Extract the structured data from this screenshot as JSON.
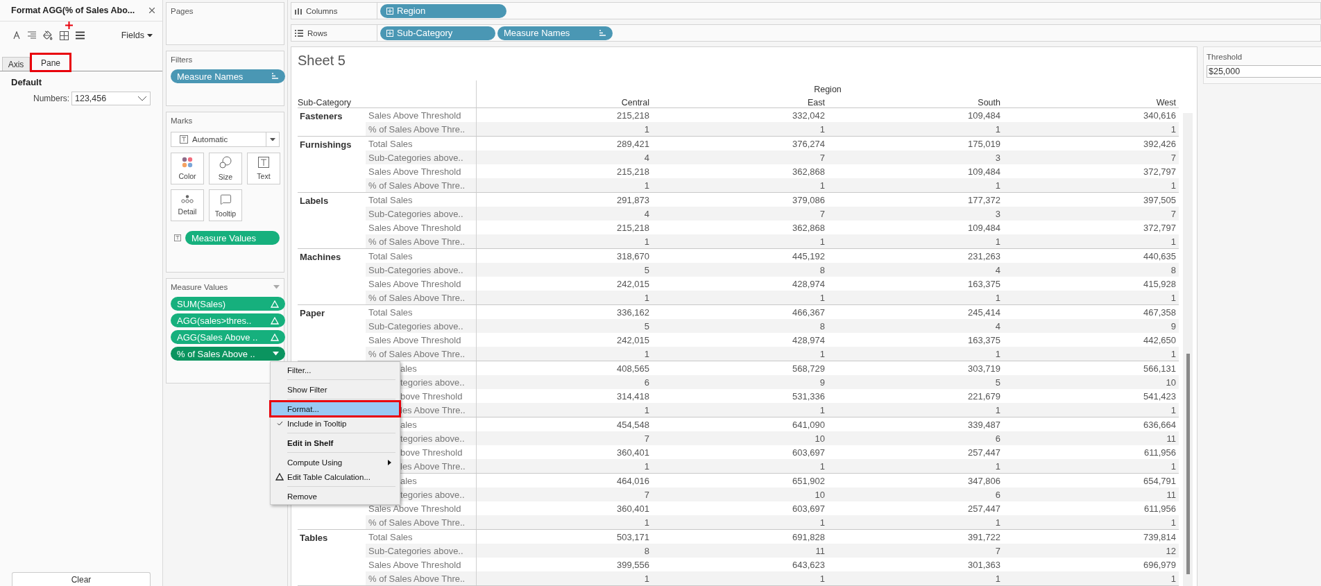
{
  "format_pane": {
    "title": "Format AGG(% of Sales Abo...",
    "fields_button": "Fields",
    "tabs": [
      {
        "label": "Axis",
        "selected": false,
        "annotated": false
      },
      {
        "label": "Pane",
        "selected": true,
        "annotated": true
      }
    ],
    "section": "Default",
    "numbers_label": "Numbers:",
    "numbers_value": "123,456",
    "clear_button": "Clear"
  },
  "cards": {
    "pages": {
      "title": "Pages"
    },
    "filters": {
      "title": "Filters",
      "pills": [
        {
          "label": "Measure Names",
          "kind": "sorted"
        }
      ]
    },
    "marks": {
      "title": "Marks",
      "mark_type": "Automatic",
      "buttons": [
        {
          "label": "Color",
          "kind": "color"
        },
        {
          "label": "Size",
          "kind": "size"
        },
        {
          "label": "Text",
          "kind": "text"
        },
        {
          "label": "Detail",
          "kind": "detail"
        },
        {
          "label": "Tooltip",
          "kind": "tooltip"
        }
      ],
      "text_pill": "Measure Values"
    },
    "measure_values": {
      "title": "Measure Values",
      "pills": [
        {
          "label": "SUM(Sales)",
          "selected": false
        },
        {
          "label": "AGG(sales>thres..",
          "selected": false
        },
        {
          "label": "AGG(Sales Above ..",
          "selected": false
        },
        {
          "label": "% of Sales Above ..",
          "selected": true
        }
      ]
    }
  },
  "shelves": [
    {
      "kind": "columns",
      "label": "Columns",
      "pills": [
        {
          "label": "Region",
          "kind": "hierarchy"
        }
      ]
    },
    {
      "kind": "rows",
      "label": "Rows",
      "pills": [
        {
          "label": "Sub-Category",
          "kind": "hierarchy"
        },
        {
          "label": "Measure Names",
          "kind": "sorted"
        }
      ]
    }
  ],
  "sheet": {
    "title": "Sheet 5",
    "column_header": "Region",
    "row_header": "Sub-Category",
    "columns": [
      "Central",
      "East",
      "South",
      "West"
    ],
    "groups": [
      {
        "name": "Fasteners",
        "rows": [
          {
            "label": "Sales Above Threshold",
            "covered": false,
            "values": [
              "215,218",
              "332,042",
              "109,484",
              "340,616"
            ]
          },
          {
            "label": "% of Sales Above Thre..",
            "covered": false,
            "values": [
              "1",
              "1",
              "1",
              "1"
            ]
          }
        ]
      },
      {
        "name": "Furnishings",
        "rows": [
          {
            "label": "Total Sales",
            "covered": false,
            "values": [
              "289,421",
              "376,274",
              "175,019",
              "392,426"
            ]
          },
          {
            "label": "Sub-Categories above..",
            "covered": false,
            "values": [
              "4",
              "7",
              "3",
              "7"
            ]
          },
          {
            "label": "Sales Above Threshold",
            "covered": false,
            "values": [
              "215,218",
              "362,868",
              "109,484",
              "372,797"
            ]
          },
          {
            "label": "% of Sales Above Thre..",
            "covered": false,
            "values": [
              "1",
              "1",
              "1",
              "1"
            ]
          }
        ]
      },
      {
        "name": "Labels",
        "rows": [
          {
            "label": "Total Sales",
            "covered": false,
            "values": [
              "291,873",
              "379,086",
              "177,372",
              "397,505"
            ]
          },
          {
            "label": "Sub-Categories above..",
            "covered": false,
            "values": [
              "4",
              "7",
              "3",
              "7"
            ]
          },
          {
            "label": "Sales Above Threshold",
            "covered": false,
            "values": [
              "215,218",
              "362,868",
              "109,484",
              "372,797"
            ]
          },
          {
            "label": "% of Sales Above Thre..",
            "covered": false,
            "values": [
              "1",
              "1",
              "1",
              "1"
            ]
          }
        ]
      },
      {
        "name": "Machines",
        "rows": [
          {
            "label": "Total Sales",
            "covered": false,
            "values": [
              "318,670",
              "445,192",
              "231,263",
              "440,635"
            ]
          },
          {
            "label": "Sub-Categories above..",
            "covered": false,
            "values": [
              "5",
              "8",
              "4",
              "8"
            ]
          },
          {
            "label": "Sales Above Threshold",
            "covered": false,
            "values": [
              "242,015",
              "428,974",
              "163,375",
              "415,928"
            ]
          },
          {
            "label": "% of Sales Above Thre..",
            "covered": false,
            "values": [
              "1",
              "1",
              "1",
              "1"
            ]
          }
        ]
      },
      {
        "name": "Paper",
        "rows": [
          {
            "label": "Total Sales",
            "covered": false,
            "values": [
              "336,162",
              "466,367",
              "245,414",
              "467,358"
            ]
          },
          {
            "label": "Sub-Categories above..",
            "covered": false,
            "values": [
              "5",
              "8",
              "4",
              "9"
            ]
          },
          {
            "label": "Sales Above Threshold",
            "covered": false,
            "values": [
              "242,015",
              "428,974",
              "163,375",
              "442,650"
            ]
          },
          {
            "label": "% of Sales Above Thre..",
            "covered": false,
            "values": [
              "1",
              "1",
              "1",
              "1"
            ]
          }
        ]
      },
      {
        "rows": [
          {
            "label": "ales",
            "covered": true,
            "values": [
              "408,565",
              "568,729",
              "303,719",
              "566,131"
            ]
          },
          {
            "label": "tegories above..",
            "covered": true,
            "values": [
              "6",
              "9",
              "5",
              "10"
            ]
          },
          {
            "label": "bove Threshold",
            "covered": true,
            "values": [
              "314,418",
              "531,336",
              "221,679",
              "541,423"
            ]
          },
          {
            "label": "les Above Thre..",
            "covered": true,
            "values": [
              "1",
              "1",
              "1",
              "1"
            ]
          }
        ]
      },
      {
        "rows": [
          {
            "label": "ales",
            "covered": true,
            "values": [
              "454,548",
              "641,090",
              "339,487",
              "636,664"
            ]
          },
          {
            "label": "tegories above..",
            "covered": true,
            "values": [
              "7",
              "10",
              "6",
              "11"
            ]
          },
          {
            "label": "bove Threshold",
            "covered": true,
            "values": [
              "360,401",
              "603,697",
              "257,447",
              "611,956"
            ]
          },
          {
            "label": "les Above Thre..",
            "covered": true,
            "values": [
              "1",
              "1",
              "1",
              "1"
            ]
          }
        ]
      },
      {
        "rows": [
          {
            "label": "ales",
            "covered": true,
            "values": [
              "464,016",
              "651,902",
              "347,806",
              "654,791"
            ]
          },
          {
            "label": "tegories above..",
            "covered": true,
            "values": [
              "7",
              "10",
              "6",
              "11"
            ]
          },
          {
            "label": "Sales Above Threshold",
            "covered": false,
            "values": [
              "360,401",
              "603,697",
              "257,447",
              "611,956"
            ]
          },
          {
            "label": "% of Sales Above Thre..",
            "covered": false,
            "values": [
              "1",
              "1",
              "1",
              "1"
            ]
          }
        ]
      },
      {
        "name": "Tables",
        "rows": [
          {
            "label": "Total Sales",
            "covered": false,
            "values": [
              "503,171",
              "691,828",
              "391,722",
              "739,814"
            ]
          },
          {
            "label": "Sub-Categories above..",
            "covered": false,
            "values": [
              "8",
              "11",
              "7",
              "12"
            ]
          },
          {
            "label": "Sales Above Threshold",
            "covered": false,
            "values": [
              "399,556",
              "643,623",
              "301,363",
              "696,979"
            ]
          },
          {
            "label": "% of Sales Above Thre..",
            "covered": false,
            "values": [
              "1",
              "1",
              "1",
              "1"
            ]
          }
        ]
      }
    ]
  },
  "threshold": {
    "title": "Threshold",
    "value": "$25,000"
  },
  "context_menu": {
    "items": [
      {
        "kind": "item",
        "label": "Filter...",
        "selected": false,
        "checked": false,
        "annotated": false
      },
      {
        "kind": "separator"
      },
      {
        "kind": "item",
        "label": "Show Filter",
        "selected": false,
        "checked": false,
        "annotated": false
      },
      {
        "kind": "separator"
      },
      {
        "kind": "item",
        "label": "Format...",
        "selected": true,
        "checked": false,
        "annotated": true
      },
      {
        "kind": "item",
        "label": "Include in Tooltip",
        "selected": false,
        "checked": true,
        "annotated": false
      },
      {
        "kind": "separator"
      },
      {
        "kind": "bold-item",
        "label": "Edit in Shelf",
        "selected": false,
        "checked": false,
        "annotated": false
      },
      {
        "kind": "separator"
      },
      {
        "kind": "submenu",
        "label": "Compute Using",
        "selected": false,
        "checked": false,
        "annotated": false
      },
      {
        "kind": "calc-item",
        "label": "Edit Table Calculation...",
        "selected": false,
        "checked": false,
        "annotated": false
      },
      {
        "kind": "separator"
      },
      {
        "kind": "item",
        "label": "Remove",
        "selected": false,
        "checked": false,
        "annotated": false
      }
    ]
  }
}
